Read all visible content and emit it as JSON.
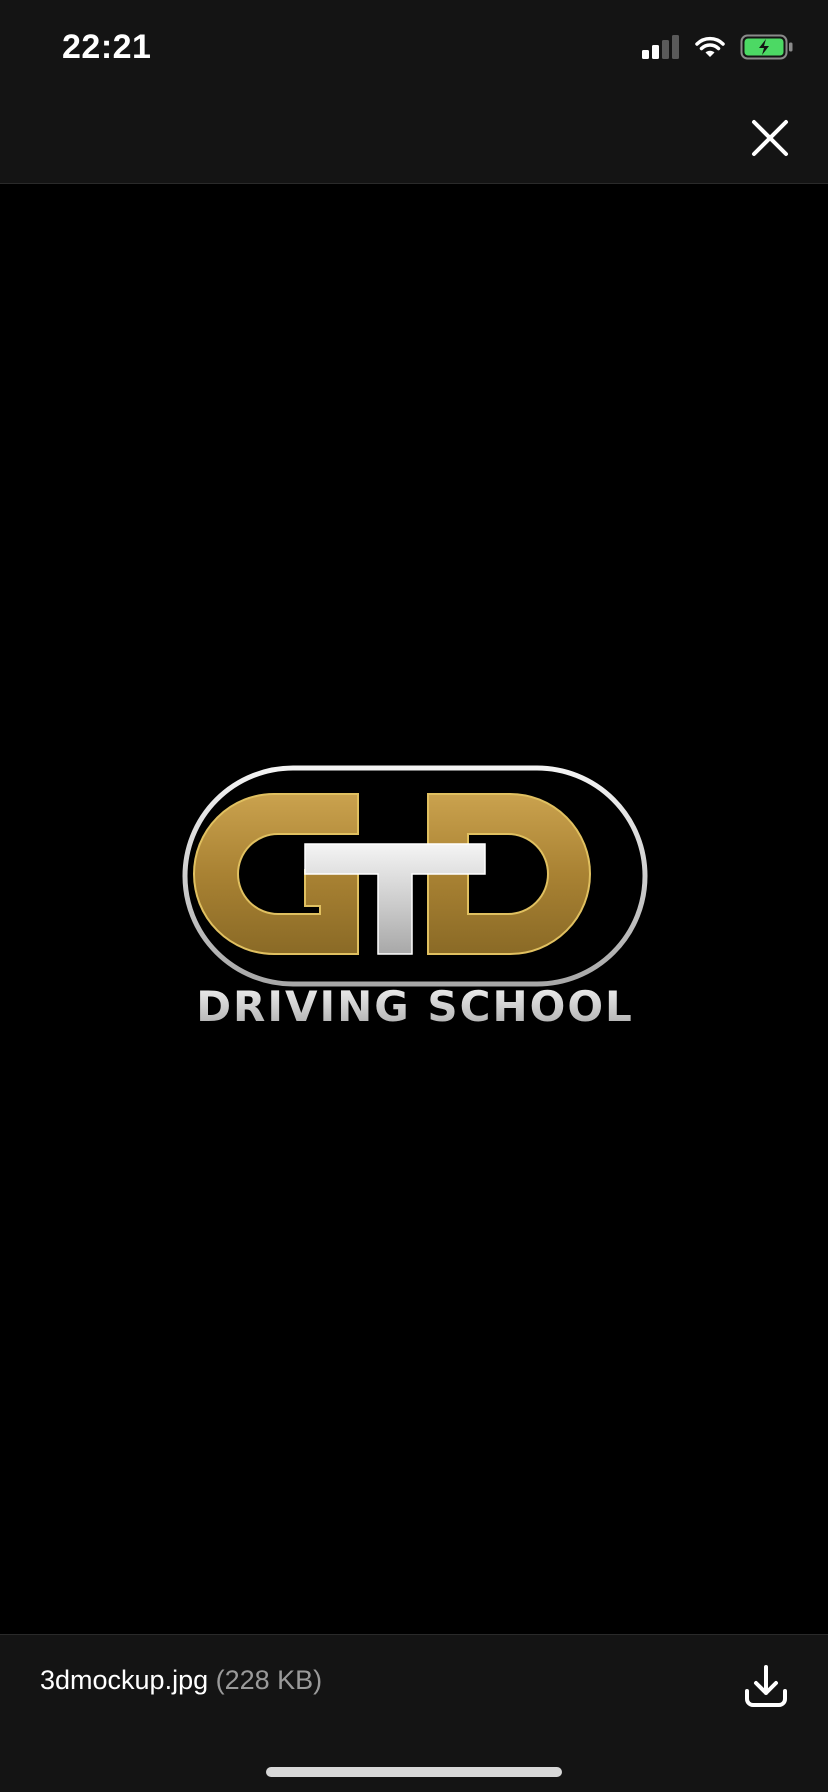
{
  "status_bar": {
    "time": "22:21",
    "icons": [
      "cellular-signal-icon",
      "wifi-icon",
      "battery-charging-icon"
    ]
  },
  "top_bar": {
    "close_icon": "close-icon"
  },
  "image": {
    "logo_letters": "GTD",
    "logo_tagline": "DRIVING SCHOOL",
    "colors": {
      "gold": "#b08a34",
      "silver": "#d8d8d8",
      "background": "#000000"
    }
  },
  "bottom_bar": {
    "file_name": "3dmockup.jpg",
    "file_size": "(228 KB)",
    "download_icon": "download-icon"
  },
  "colors": {
    "bar_background": "#141414",
    "battery_green": "#4cd964"
  }
}
